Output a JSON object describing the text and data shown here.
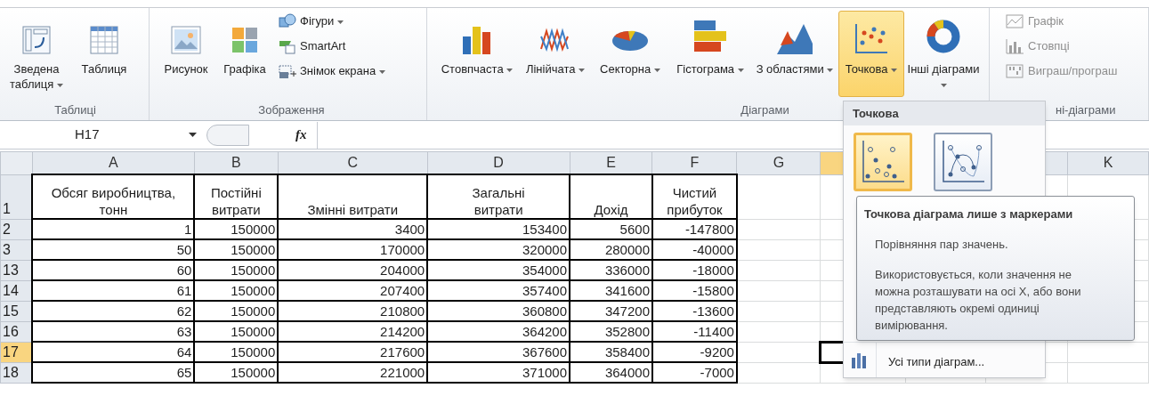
{
  "ribbon": {
    "groups": [
      {
        "label": "Таблиці",
        "buttons": [
          {
            "label": "Зведена таблиця",
            "kind": "large",
            "dropdown": true,
            "selected": false,
            "disabled": false
          },
          {
            "label": "Таблиця",
            "kind": "large",
            "dropdown": false,
            "selected": false,
            "disabled": false
          }
        ]
      },
      {
        "label": "Зображення",
        "buttons": [
          {
            "label": "Рисунок",
            "kind": "large",
            "dropdown": false,
            "selected": false,
            "disabled": false
          },
          {
            "label": "Графіка",
            "kind": "large",
            "dropdown": false,
            "selected": false,
            "disabled": false
          },
          {
            "label": "Фігури",
            "kind": "small",
            "dropdown": true,
            "selected": false,
            "disabled": false
          },
          {
            "label": "SmartArt",
            "kind": "small",
            "dropdown": false,
            "selected": false,
            "disabled": false
          },
          {
            "label": "Знімок екрана",
            "kind": "small",
            "dropdown": true,
            "selected": false,
            "disabled": false
          }
        ]
      },
      {
        "label": "Діаграми",
        "buttons": [
          {
            "label": "Стовпчаста",
            "kind": "large",
            "dropdown": true,
            "selected": false,
            "disabled": false
          },
          {
            "label": "Лінійчата",
            "kind": "large",
            "dropdown": true,
            "selected": false,
            "disabled": false
          },
          {
            "label": "Секторна",
            "kind": "large",
            "dropdown": true,
            "selected": false,
            "disabled": false
          },
          {
            "label": "Гістограма",
            "kind": "large",
            "dropdown": true,
            "selected": false,
            "disabled": false
          },
          {
            "label": "З областями",
            "kind": "large",
            "dropdown": true,
            "selected": false,
            "disabled": false
          },
          {
            "label": "Точкова",
            "kind": "large",
            "dropdown": true,
            "selected": true,
            "disabled": false
          },
          {
            "label": "Інші діаграми",
            "kind": "large",
            "dropdown": true,
            "selected": false,
            "disabled": false
          }
        ]
      },
      {
        "label": "ні-діаграми",
        "buttons": [
          {
            "label": "Графік",
            "kind": "small",
            "dropdown": false,
            "selected": false,
            "disabled": true
          },
          {
            "label": "Стовпці",
            "kind": "small",
            "dropdown": false,
            "selected": false,
            "disabled": true
          },
          {
            "label": "Виграш/програш",
            "kind": "small",
            "dropdown": false,
            "selected": false,
            "disabled": true
          }
        ]
      }
    ]
  },
  "formula_bar": {
    "name_box": "H17",
    "function_symbol": "fx"
  },
  "sheet": {
    "columns": [
      {
        "label": "A",
        "selected": false
      },
      {
        "label": "B",
        "selected": false
      },
      {
        "label": "C",
        "selected": false
      },
      {
        "label": "D",
        "selected": false
      },
      {
        "label": "E",
        "selected": false
      },
      {
        "label": "F",
        "selected": false
      },
      {
        "label": "G",
        "selected": false
      },
      {
        "selected": true
      },
      {},
      {},
      {
        "label": "K",
        "selected": false
      }
    ],
    "rows": [
      {
        "number": "1",
        "kind": "header",
        "selected": false,
        "cells": [
          "Обсяг виробництва, тонн",
          "Постійні витрати",
          "Змінні витрати",
          "Загальні витрати",
          "Дохід",
          "Чистий прибуток"
        ]
      },
      {
        "number": "2",
        "kind": "data",
        "selected": false,
        "cells": [
          "1",
          "150000",
          "3400",
          "153400",
          "5600",
          "-147800"
        ]
      },
      {
        "number": "3",
        "kind": "data",
        "selected": false,
        "cells": [
          "50",
          "150000",
          "170000",
          "320000",
          "280000",
          "-40000"
        ]
      },
      {
        "number": "13",
        "kind": "data",
        "selected": false,
        "cells": [
          "60",
          "150000",
          "204000",
          "354000",
          "336000",
          "-18000"
        ]
      },
      {
        "number": "14",
        "kind": "data",
        "selected": false,
        "cells": [
          "61",
          "150000",
          "207400",
          "357400",
          "341600",
          "-15800"
        ]
      },
      {
        "number": "15",
        "kind": "data",
        "selected": false,
        "cells": [
          "62",
          "150000",
          "210800",
          "360800",
          "347200",
          "-13600"
        ]
      },
      {
        "number": "16",
        "kind": "data",
        "selected": false,
        "cells": [
          "63",
          "150000",
          "214200",
          "364200",
          "352800",
          "-11400"
        ]
      },
      {
        "number": "17",
        "kind": "data",
        "selected": true,
        "cells": [
          "64",
          "150000",
          "217600",
          "367600",
          "358400",
          "-9200"
        ]
      },
      {
        "number": "18",
        "kind": "data",
        "selected": false,
        "cells": [
          "65",
          "150000",
          "221000",
          "371000",
          "364000",
          "-7000"
        ]
      }
    ]
  },
  "dropdown": {
    "title": "Точкова",
    "options": [
      {
        "selected": true
      },
      {
        "selected": false
      }
    ],
    "footer": "Усі типи діаграм..."
  },
  "tooltip": {
    "title": "Точкова діаграма лише з маркерами",
    "paragraphs": [
      "Порівняння пар значень.",
      "Використовується, коли значення не можна розташувати на осі X, або вони представляють окремі одиниці вимірювання."
    ]
  }
}
